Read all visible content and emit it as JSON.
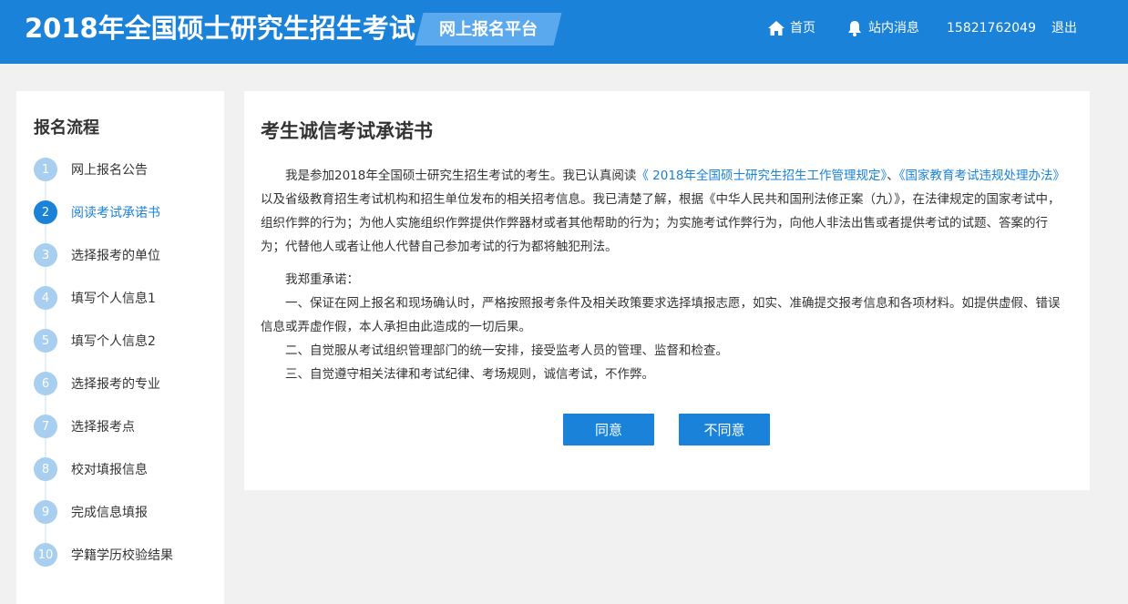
{
  "header": {
    "site_title": "2018年全国硕士研究生招生考试",
    "platform_label": "网上报名平台",
    "nav": {
      "home_label": "首页",
      "messages_label": "站内消息",
      "phone": "15821762049",
      "logout_label": "退出"
    }
  },
  "sidebar": {
    "title": "报名流程",
    "steps": [
      {
        "num": "1",
        "label": "网上报名公告"
      },
      {
        "num": "2",
        "label": "阅读考试承诺书"
      },
      {
        "num": "3",
        "label": "选择报考的单位"
      },
      {
        "num": "4",
        "label": "填写个人信息1"
      },
      {
        "num": "5",
        "label": "填写个人信息2"
      },
      {
        "num": "6",
        "label": "选择报考的专业"
      },
      {
        "num": "7",
        "label": "选择报考点"
      },
      {
        "num": "8",
        "label": "校对填报信息"
      },
      {
        "num": "9",
        "label": "完成信息填报"
      },
      {
        "num": "10",
        "label": "学籍学历校验结果"
      }
    ],
    "active_step": "2"
  },
  "main": {
    "title": "考生诚信考试承诺书",
    "intro_before_link": "我是参加2018年全国硕士研究生招生考试的考生。我已认真阅读",
    "link1": "《 2018年全国硕士研究生招生工作管理规定》",
    "sep": "、",
    "link2": "《国家教育考试违规处理办法》",
    "intro_after_link": "以及省级教育招生考试机构和招生单位发布的相关招考信息。我已清楚了解，根据《中华人民共和国刑法修正案（九）》，在法律规定的国家考试中，组织作弊的行为；为他人实施组织作弊提供作弊器材或者其他帮助的行为；为实施考试作弊行为，向他人非法出售或者提供考试的试题、答案的行为；代替他人或者让他人代替自己参加考试的行为都将触犯刑法。",
    "pledge_heading": "我郑重承诺：",
    "pledges": [
      "一、保证在网上报名和现场确认时，严格按照报考条件及相关政策要求选择填报志愿，如实、准确提交报考信息和各项材料。如提供虚假、错误信息或弄虚作假，本人承担由此造成的一切后果。",
      "二、自觉服从考试组织管理部门的统一安排，接受监考人员的管理、监督和检查。",
      "三、自觉遵守相关法律和考试纪律、考场规则，诚信考试，不作弊。"
    ],
    "agree_label": "同意",
    "disagree_label": "不同意"
  },
  "colors": {
    "brand_blue": "#1a82d9",
    "step_inactive": "#a8cff0",
    "background": "#f1f1f1"
  }
}
